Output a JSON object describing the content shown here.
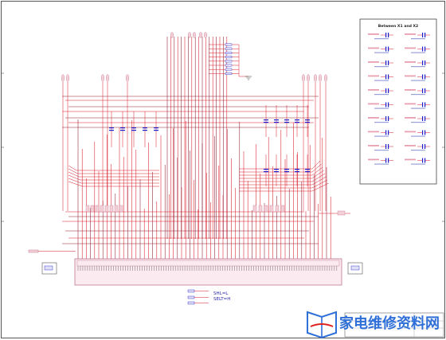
{
  "schematic": {
    "panel_title": "Between X1 and X2",
    "switch_labels": [
      "SHL=L",
      "SELT=H"
    ],
    "colors": {
      "wire_red": "#d81a28",
      "wire_dark": "#8a1a2e",
      "component_blue": "#1b1bd0",
      "connector_pink": "#c07890",
      "border": "#555555",
      "watermark_blue": "#2f6fd8",
      "watermark_red": "#e0201a"
    },
    "icons": [
      "ground-icon",
      "resistor-icon",
      "capacitor-icon",
      "connector-icon",
      "fuse-icon"
    ]
  },
  "watermark": {
    "text": "家电维修资料网",
    "logo": "book-logo"
  }
}
